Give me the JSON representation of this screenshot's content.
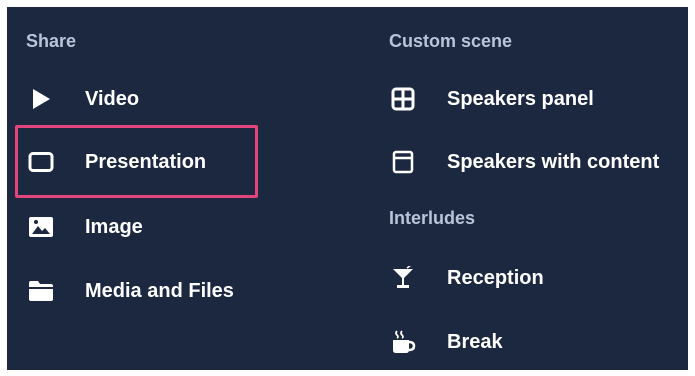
{
  "share": {
    "heading": "Share",
    "items": [
      {
        "label": "Video",
        "icon": "play-icon"
      },
      {
        "label": "Presentation",
        "icon": "presentation-icon"
      },
      {
        "label": "Image",
        "icon": "image-icon"
      },
      {
        "label": "Media and Files",
        "icon": "folder-icon"
      }
    ]
  },
  "custom_scene": {
    "heading": "Custom scene",
    "items": [
      {
        "label": "Speakers panel",
        "icon": "grid-icon"
      },
      {
        "label": "Speakers with content",
        "icon": "window-icon"
      }
    ]
  },
  "interludes": {
    "heading": "Interludes",
    "items": [
      {
        "label": "Reception",
        "icon": "cocktail-icon"
      },
      {
        "label": "Break",
        "icon": "coffee-icon"
      }
    ]
  },
  "colors": {
    "panel_background": "#1c2740",
    "heading": "#b9c4d9",
    "label": "#ffffff",
    "highlight": "#e0457b"
  }
}
